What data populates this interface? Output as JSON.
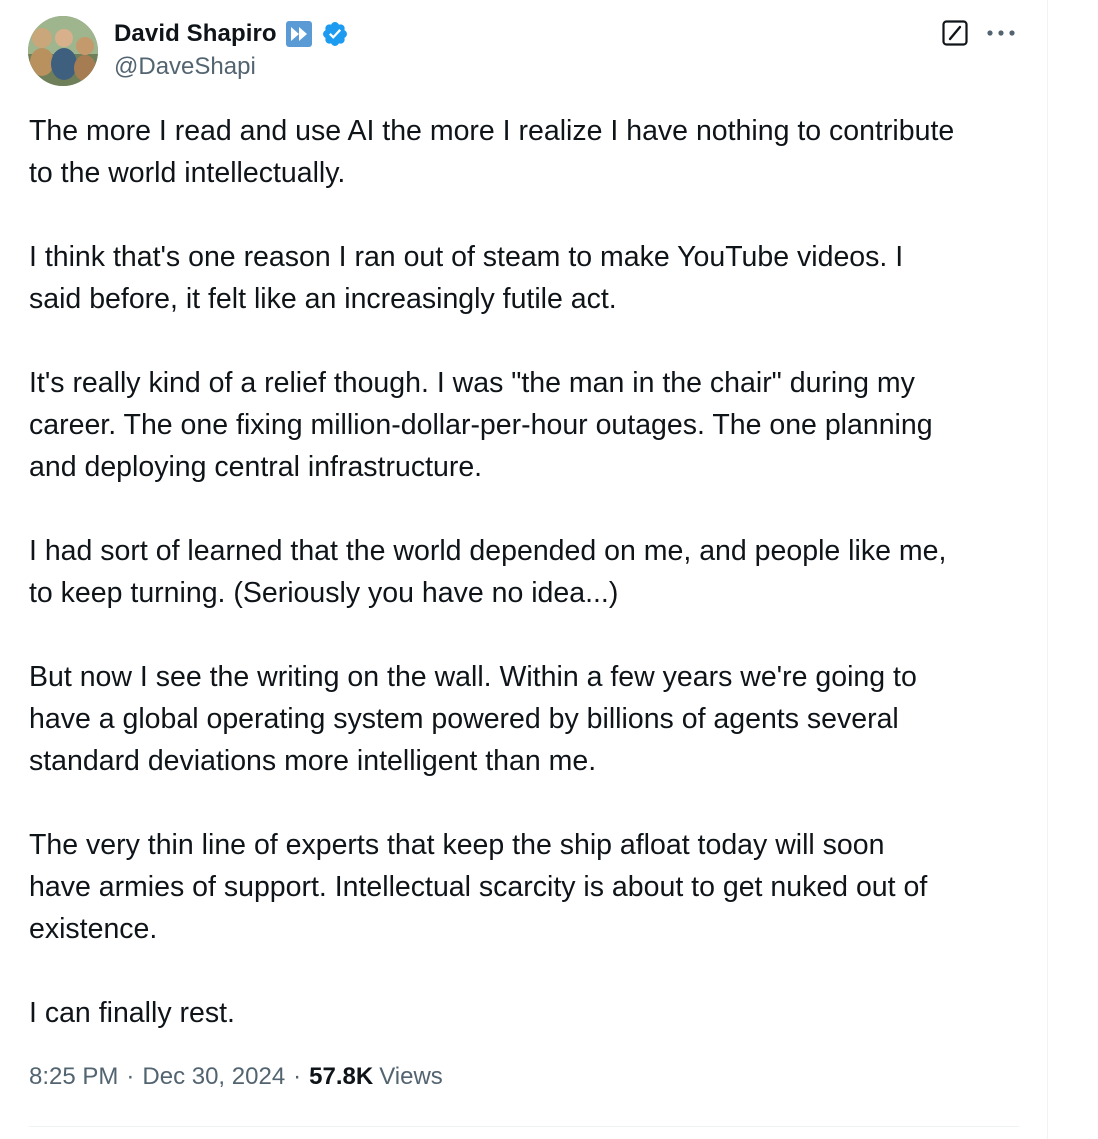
{
  "author": {
    "name": "David Shapiro",
    "handle": "@DaveShapi",
    "avatar_icon": "profile-photo",
    "badges": [
      "fast-forward-icon",
      "verified-badge-icon"
    ],
    "verified_color": "#1d9bf0",
    "ff_badge_color": "#5b9bd5"
  },
  "actions": {
    "grok_icon": "grok-icon",
    "more_icon": "more-icon"
  },
  "tweet": {
    "paragraphs": [
      "The more I read and use AI the more I realize I have nothing to contribute\nto the world intellectually.",
      "I think that's one reason I ran out of steam to make YouTube videos. I\nsaid before, it felt like an increasingly futile act.",
      "It's really kind of a relief though. I was \"the man in the chair\" during my\ncareer. The one fixing million-dollar-per-hour outages. The one planning\nand deploying central infrastructure.",
      "I had sort of learned that the world depended on me, and people like me,\nto keep turning. (Seriously you have no idea...)",
      "But now I see the writing on the wall. Within a few years we're going to\nhave a global operating system powered by billions of agents several\nstandard deviations more intelligent than me.",
      "The very thin line of experts that keep the ship afloat today will soon\nhave armies of support. Intellectual scarcity is about to get nuked out of\nexistence.",
      "I can finally rest."
    ]
  },
  "meta": {
    "time": "8:25 PM",
    "separator": "·",
    "date": "Dec 30, 2024",
    "views_count": "57.8K",
    "views_label": "Views"
  }
}
